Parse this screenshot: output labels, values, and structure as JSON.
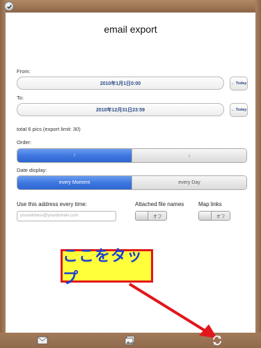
{
  "header": {
    "title": "email export"
  },
  "from": {
    "label": "From:",
    "value": "2010年1月1日0:00",
    "today_label": "← Today"
  },
  "to": {
    "label": "To:",
    "value": "2010年12月31日23:59",
    "today_label": "← Today"
  },
  "summary": "total 6 pics (export limit: 30)",
  "order": {
    "label": "Order:",
    "options": [
      "↑",
      "↓"
    ],
    "selected": 0
  },
  "date_display": {
    "label": "Date display:",
    "options": [
      "every   Moment",
      "every   Day"
    ],
    "selected": 0
  },
  "address": {
    "label": "Use this address every time:",
    "placeholder": "youraddress@yourdomain.com"
  },
  "attached": {
    "label": "Attached file names",
    "state": "オフ"
  },
  "map_links": {
    "label": "Map links",
    "state": "オフ"
  },
  "annotation": {
    "text": "ここをタップ",
    "color": "#1a3fd0",
    "background": "#ffff3a",
    "border": "#e2161b"
  },
  "toolbar": {
    "icons": [
      "mail-icon",
      "photos-icon",
      "refresh-icon"
    ]
  },
  "colors": {
    "accent": "#3f78e0",
    "field_text": "#2c4a86"
  }
}
